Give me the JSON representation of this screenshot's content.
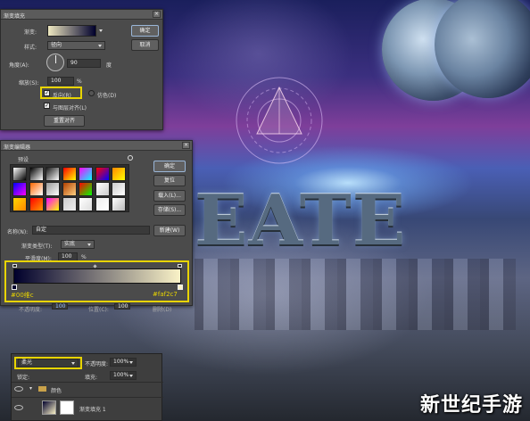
{
  "gradient_fill": {
    "title": "渐变填充",
    "close": "×",
    "labels": {
      "gradient": "渐变:",
      "style": "样式:",
      "angle": "角度(A):",
      "scale": "缩放(S):",
      "percent": "%",
      "degree": "度"
    },
    "style_value": "径向",
    "angle_value": "90",
    "scale_value": "100",
    "reverse_label": "反向(R)",
    "reverse_checked": true,
    "dither_label": "仿色(D)",
    "align_label": "与图层对齐(L)",
    "align_checked": true,
    "reset_button": "重置对齐",
    "ok_button": "确定",
    "cancel_button": "取消"
  },
  "gradient_editor": {
    "title": "渐变编辑器",
    "close": "×",
    "presets_label": "预设",
    "ok_button": "确定",
    "reset_button": "复位",
    "load_button": "载入(L)...",
    "save_button": "存储(S)...",
    "name_label": "名称(N):",
    "name_value": "自定",
    "new_button": "新建(W)",
    "type_label": "渐变类型(T):",
    "type_value": "实底",
    "smooth_label": "平滑度(M):",
    "smooth_value": "100",
    "smooth_unit": "%",
    "left_color": "#00002c",
    "left_text": "#00维c",
    "right_color": "#faf2c7",
    "right_text": "#faf2c7",
    "stops_label": "色标",
    "opacity_label": "不透明度:",
    "opacity_value": "100",
    "location_label": "位置(C):",
    "location_value": "100",
    "delete_button": "删除(D)",
    "preset_colors": [
      [
        "#ffffff",
        "#000000"
      ],
      [
        "#000000",
        "#ffffff"
      ],
      [
        "#1a1a1a",
        "#ffffff"
      ],
      [
        "#ff0000",
        "#ffff00"
      ],
      [
        "#ff00ff",
        "#00ffff"
      ],
      [
        "#ff0000",
        "#0000ff"
      ],
      [
        "#ff8800",
        "#ffff00"
      ],
      [
        "#0000ff",
        "#ff00ff"
      ],
      [
        "#ff6600",
        "#ffffff"
      ],
      [
        "#999999",
        "#ffffff"
      ],
      [
        "#b04000",
        "#ffd080"
      ],
      [
        "#ff0000",
        "#00ff00"
      ],
      [
        "#ffffff",
        "#cccccc"
      ],
      [
        "#cccccc",
        "#ffffff"
      ],
      [
        "#ffd700",
        "#ff8800"
      ],
      [
        "#ff0000",
        "#ff9900"
      ],
      [
        "#ff00ff",
        "#ffff00"
      ],
      [
        "#cccccc",
        "#eeeeee"
      ],
      [
        "#ffffff",
        "#dddddd"
      ],
      [
        "#eeeeee",
        "#ffffff"
      ],
      [
        "#ffffff",
        "#bbbbbb"
      ]
    ]
  },
  "layers": {
    "blend_mode": "柔光",
    "opacity_label": "不透明度:",
    "opacity_value": "100%",
    "lock_label": "锁定:",
    "fill_label": "填充:",
    "fill_value": "100%",
    "group_name": "颜色",
    "layer_name": "渐变填充 1"
  },
  "artwork": {
    "title_text": "EATE",
    "watermark": "新世纪手游"
  }
}
